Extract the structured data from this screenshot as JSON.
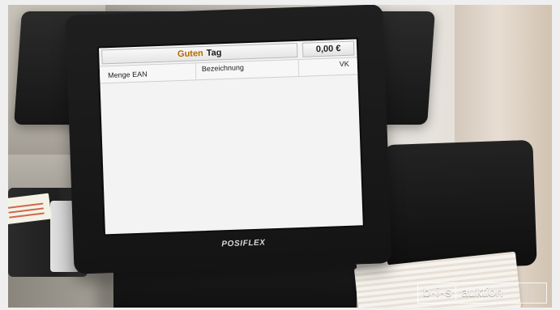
{
  "screen": {
    "greeting_part1": "Guten",
    "greeting_part2": "Tag",
    "total": "0,00 €",
    "columns": {
      "menge": "Menge",
      "ean": "EAN",
      "bezeichnung": "Bezeichnung",
      "vk": "VK"
    }
  },
  "device": {
    "brand": "POSIFLEX"
  },
  "watermark": {
    "left": "b·i·s",
    "right": "auktion"
  }
}
